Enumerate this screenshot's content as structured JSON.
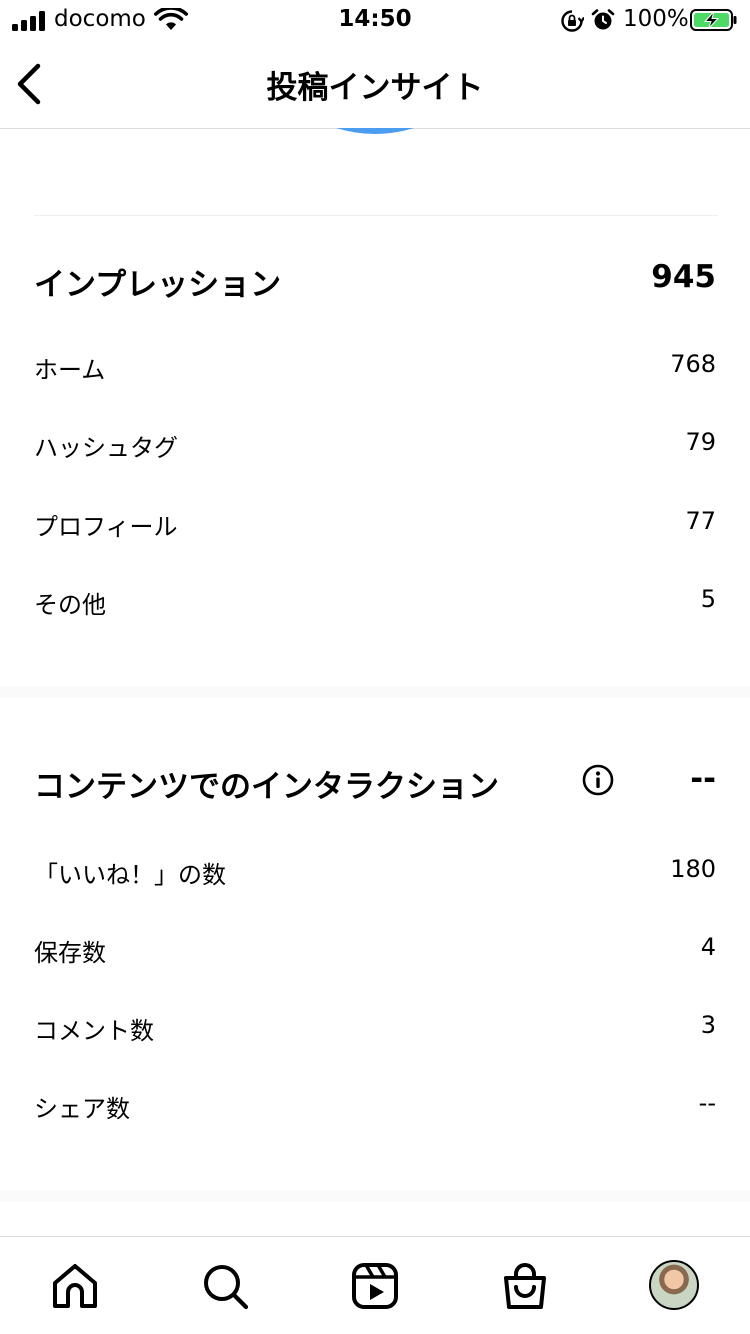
{
  "status_bar": {
    "carrier": "docomo",
    "time": "14:50",
    "battery": "100%"
  },
  "header": {
    "title": "投稿インサイト"
  },
  "impressions": {
    "title": "インプレッション",
    "total": "945",
    "rows": [
      {
        "label": "ホーム",
        "value": "768"
      },
      {
        "label": "ハッシュタグ",
        "value": "79"
      },
      {
        "label": "プロフィール",
        "value": "77"
      },
      {
        "label": "その他",
        "value": "5"
      }
    ]
  },
  "interactions": {
    "title": "コンテンツでのインタラクション",
    "total": "--",
    "rows": [
      {
        "label": "「いいね！」の数",
        "value": "180"
      },
      {
        "label": "保存数",
        "value": "4"
      },
      {
        "label": "コメント数",
        "value": "3"
      },
      {
        "label": "シェア数",
        "value": "--"
      }
    ]
  },
  "icons": {
    "back": "chevron-left-icon",
    "info": "info-icon",
    "tabs": [
      "home-icon",
      "search-icon",
      "reels-icon",
      "shop-icon",
      "profile-avatar"
    ]
  },
  "colors": {
    "accent_blue": "#4a9df0",
    "battery_green": "#4cd964"
  }
}
